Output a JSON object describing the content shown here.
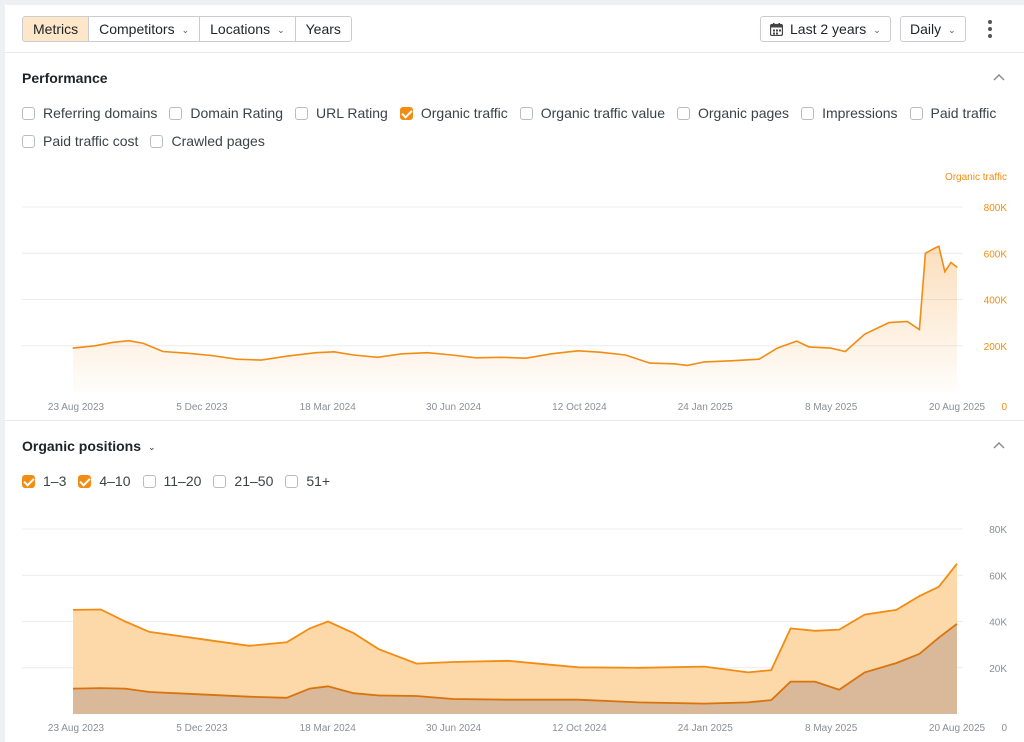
{
  "toolbar": {
    "tabs": [
      {
        "label": "Metrics",
        "active": true,
        "dropdown": false
      },
      {
        "label": "Competitors",
        "active": false,
        "dropdown": true
      },
      {
        "label": "Locations",
        "active": false,
        "dropdown": true
      },
      {
        "label": "Years",
        "active": false,
        "dropdown": false
      }
    ],
    "date_range": "Last 2 years",
    "interval": "Daily",
    "calendar_icon": "calendar-icon",
    "more_icon": "more-vertical-icon"
  },
  "performance": {
    "title": "Performance",
    "collapse_icon": "chevron-up-icon",
    "metrics": [
      {
        "label": "Referring domains",
        "checked": false
      },
      {
        "label": "Domain Rating",
        "checked": false
      },
      {
        "label": "URL Rating",
        "checked": false
      },
      {
        "label": "Organic traffic",
        "checked": true
      },
      {
        "label": "Organic traffic value",
        "checked": false
      },
      {
        "label": "Organic pages",
        "checked": false
      },
      {
        "label": "Impressions",
        "checked": false
      },
      {
        "label": "Paid traffic",
        "checked": false
      },
      {
        "label": "Paid traffic cost",
        "checked": false
      },
      {
        "label": "Crawled pages",
        "checked": false
      }
    ]
  },
  "positions": {
    "title": "Organic positions",
    "collapse_icon": "chevron-up-icon",
    "ranges": [
      {
        "label": "1–3",
        "checked": true
      },
      {
        "label": "4–10",
        "checked": true
      },
      {
        "label": "11–20",
        "checked": false
      },
      {
        "label": "21–50",
        "checked": false
      },
      {
        "label": "51+",
        "checked": false
      }
    ]
  },
  "colors": {
    "accent": "#f28c13",
    "area_light": "#fdd8a8",
    "area_dark": "#d9b99a",
    "line_dark": "#d9730d"
  },
  "chart_data": [
    {
      "type": "area",
      "series": [
        {
          "name": "Organic traffic",
          "points": [
            [
              "2023-08-23",
              190000
            ],
            [
              "2023-09-10",
              200000
            ],
            [
              "2023-09-25",
              215000
            ],
            [
              "2023-10-08",
              222000
            ],
            [
              "2023-10-20",
              210000
            ],
            [
              "2023-11-05",
              175000
            ],
            [
              "2023-11-25",
              168000
            ],
            [
              "2023-12-15",
              158000
            ],
            [
              "2024-01-05",
              142000
            ],
            [
              "2024-01-25",
              138000
            ],
            [
              "2024-02-15",
              155000
            ],
            [
              "2024-03-10",
              170000
            ],
            [
              "2024-03-25",
              174000
            ],
            [
              "2024-04-10",
              160000
            ],
            [
              "2024-04-30",
              150000
            ],
            [
              "2024-05-20",
              165000
            ],
            [
              "2024-06-10",
              170000
            ],
            [
              "2024-06-30",
              160000
            ],
            [
              "2024-07-20",
              148000
            ],
            [
              "2024-08-10",
              150000
            ],
            [
              "2024-08-30",
              146000
            ],
            [
              "2024-09-20",
              165000
            ],
            [
              "2024-10-12",
              178000
            ],
            [
              "2024-10-30",
              172000
            ],
            [
              "2024-11-20",
              160000
            ],
            [
              "2024-12-10",
              125000
            ],
            [
              "2024-12-30",
              122000
            ],
            [
              "2025-01-10",
              115000
            ],
            [
              "2025-01-24",
              130000
            ],
            [
              "2025-02-15",
              135000
            ],
            [
              "2025-03-10",
              142000
            ],
            [
              "2025-03-25",
              190000
            ],
            [
              "2025-04-10",
              220000
            ],
            [
              "2025-04-20",
              195000
            ],
            [
              "2025-05-08",
              190000
            ],
            [
              "2025-05-20",
              175000
            ],
            [
              "2025-06-05",
              250000
            ],
            [
              "2025-06-25",
              300000
            ],
            [
              "2025-07-10",
              305000
            ],
            [
              "2025-07-20",
              270000
            ],
            [
              "2025-07-25",
              600000
            ],
            [
              "2025-08-01",
              620000
            ],
            [
              "2025-08-05",
              630000
            ],
            [
              "2025-08-10",
              520000
            ],
            [
              "2025-08-15",
              560000
            ],
            [
              "2025-08-20",
              540000
            ]
          ]
        }
      ],
      "x_ticks": [
        "23 Aug 2023",
        "5 Dec 2023",
        "18 Mar 2024",
        "30 Jun 2024",
        "12 Oct 2024",
        "24 Jan 2025",
        "8 May 2025",
        "20 Aug 2025"
      ],
      "y_ticks": [
        "0",
        "200K",
        "400K",
        "600K",
        "800K"
      ],
      "y_label": "Organic traffic",
      "xlim": [
        "2023-08-23",
        "2025-08-20"
      ],
      "ylim": [
        0,
        800000
      ],
      "grid": true
    },
    {
      "type": "area",
      "stacked": true,
      "series": [
        {
          "name": "1–3",
          "points": [
            [
              "2023-08-23",
              11000
            ],
            [
              "2023-09-15",
              11200
            ],
            [
              "2023-10-05",
              11000
            ],
            [
              "2023-10-25",
              9500
            ],
            [
              "2023-12-05",
              8500
            ],
            [
              "2024-01-15",
              7500
            ],
            [
              "2024-02-15",
              7000
            ],
            [
              "2024-03-05",
              11000
            ],
            [
              "2024-03-20",
              12000
            ],
            [
              "2024-04-10",
              9000
            ],
            [
              "2024-05-01",
              8000
            ],
            [
              "2024-06-01",
              7800
            ],
            [
              "2024-07-01",
              6500
            ],
            [
              "2024-08-15",
              6200
            ],
            [
              "2024-10-12",
              6200
            ],
            [
              "2024-12-01",
              5000
            ],
            [
              "2025-01-24",
              4500
            ],
            [
              "2025-03-01",
              5000
            ],
            [
              "2025-03-20",
              6000
            ],
            [
              "2025-04-05",
              14000
            ],
            [
              "2025-04-25",
              14000
            ],
            [
              "2025-05-15",
              10500
            ],
            [
              "2025-06-05",
              18000
            ],
            [
              "2025-07-01",
              22000
            ],
            [
              "2025-07-20",
              26000
            ],
            [
              "2025-08-05",
              33000
            ],
            [
              "2025-08-20",
              39000
            ]
          ]
        },
        {
          "name": "4–10",
          "points": [
            [
              "2023-08-23",
              34000
            ],
            [
              "2023-09-15",
              34000
            ],
            [
              "2023-10-05",
              29000
            ],
            [
              "2023-10-25",
              26000
            ],
            [
              "2023-12-05",
              24000
            ],
            [
              "2024-01-15",
              22000
            ],
            [
              "2024-02-15",
              24000
            ],
            [
              "2024-03-05",
              26000
            ],
            [
              "2024-03-20",
              28000
            ],
            [
              "2024-04-10",
              26000
            ],
            [
              "2024-05-01",
              20000
            ],
            [
              "2024-06-01",
              14000
            ],
            [
              "2024-07-01",
              16000
            ],
            [
              "2024-08-15",
              16800
            ],
            [
              "2024-10-12",
              14000
            ],
            [
              "2024-12-01",
              15000
            ],
            [
              "2025-01-24",
              16000
            ],
            [
              "2025-03-01",
              13000
            ],
            [
              "2025-03-20",
              13000
            ],
            [
              "2025-04-05",
              23000
            ],
            [
              "2025-04-25",
              22000
            ],
            [
              "2025-05-15",
              26000
            ],
            [
              "2025-06-05",
              25000
            ],
            [
              "2025-07-01",
              23000
            ],
            [
              "2025-07-20",
              25000
            ],
            [
              "2025-08-05",
              22000
            ],
            [
              "2025-08-20",
              26000
            ]
          ]
        }
      ],
      "x_ticks": [
        "23 Aug 2023",
        "5 Dec 2023",
        "18 Mar 2024",
        "30 Jun 2024",
        "12 Oct 2024",
        "24 Jan 2025",
        "8 May 2025",
        "20 Aug 2025"
      ],
      "y_ticks": [
        "0",
        "20K",
        "40K",
        "60K",
        "80K"
      ],
      "xlim": [
        "2023-08-23",
        "2025-08-20"
      ],
      "ylim": [
        0,
        80000
      ],
      "grid": true
    }
  ]
}
